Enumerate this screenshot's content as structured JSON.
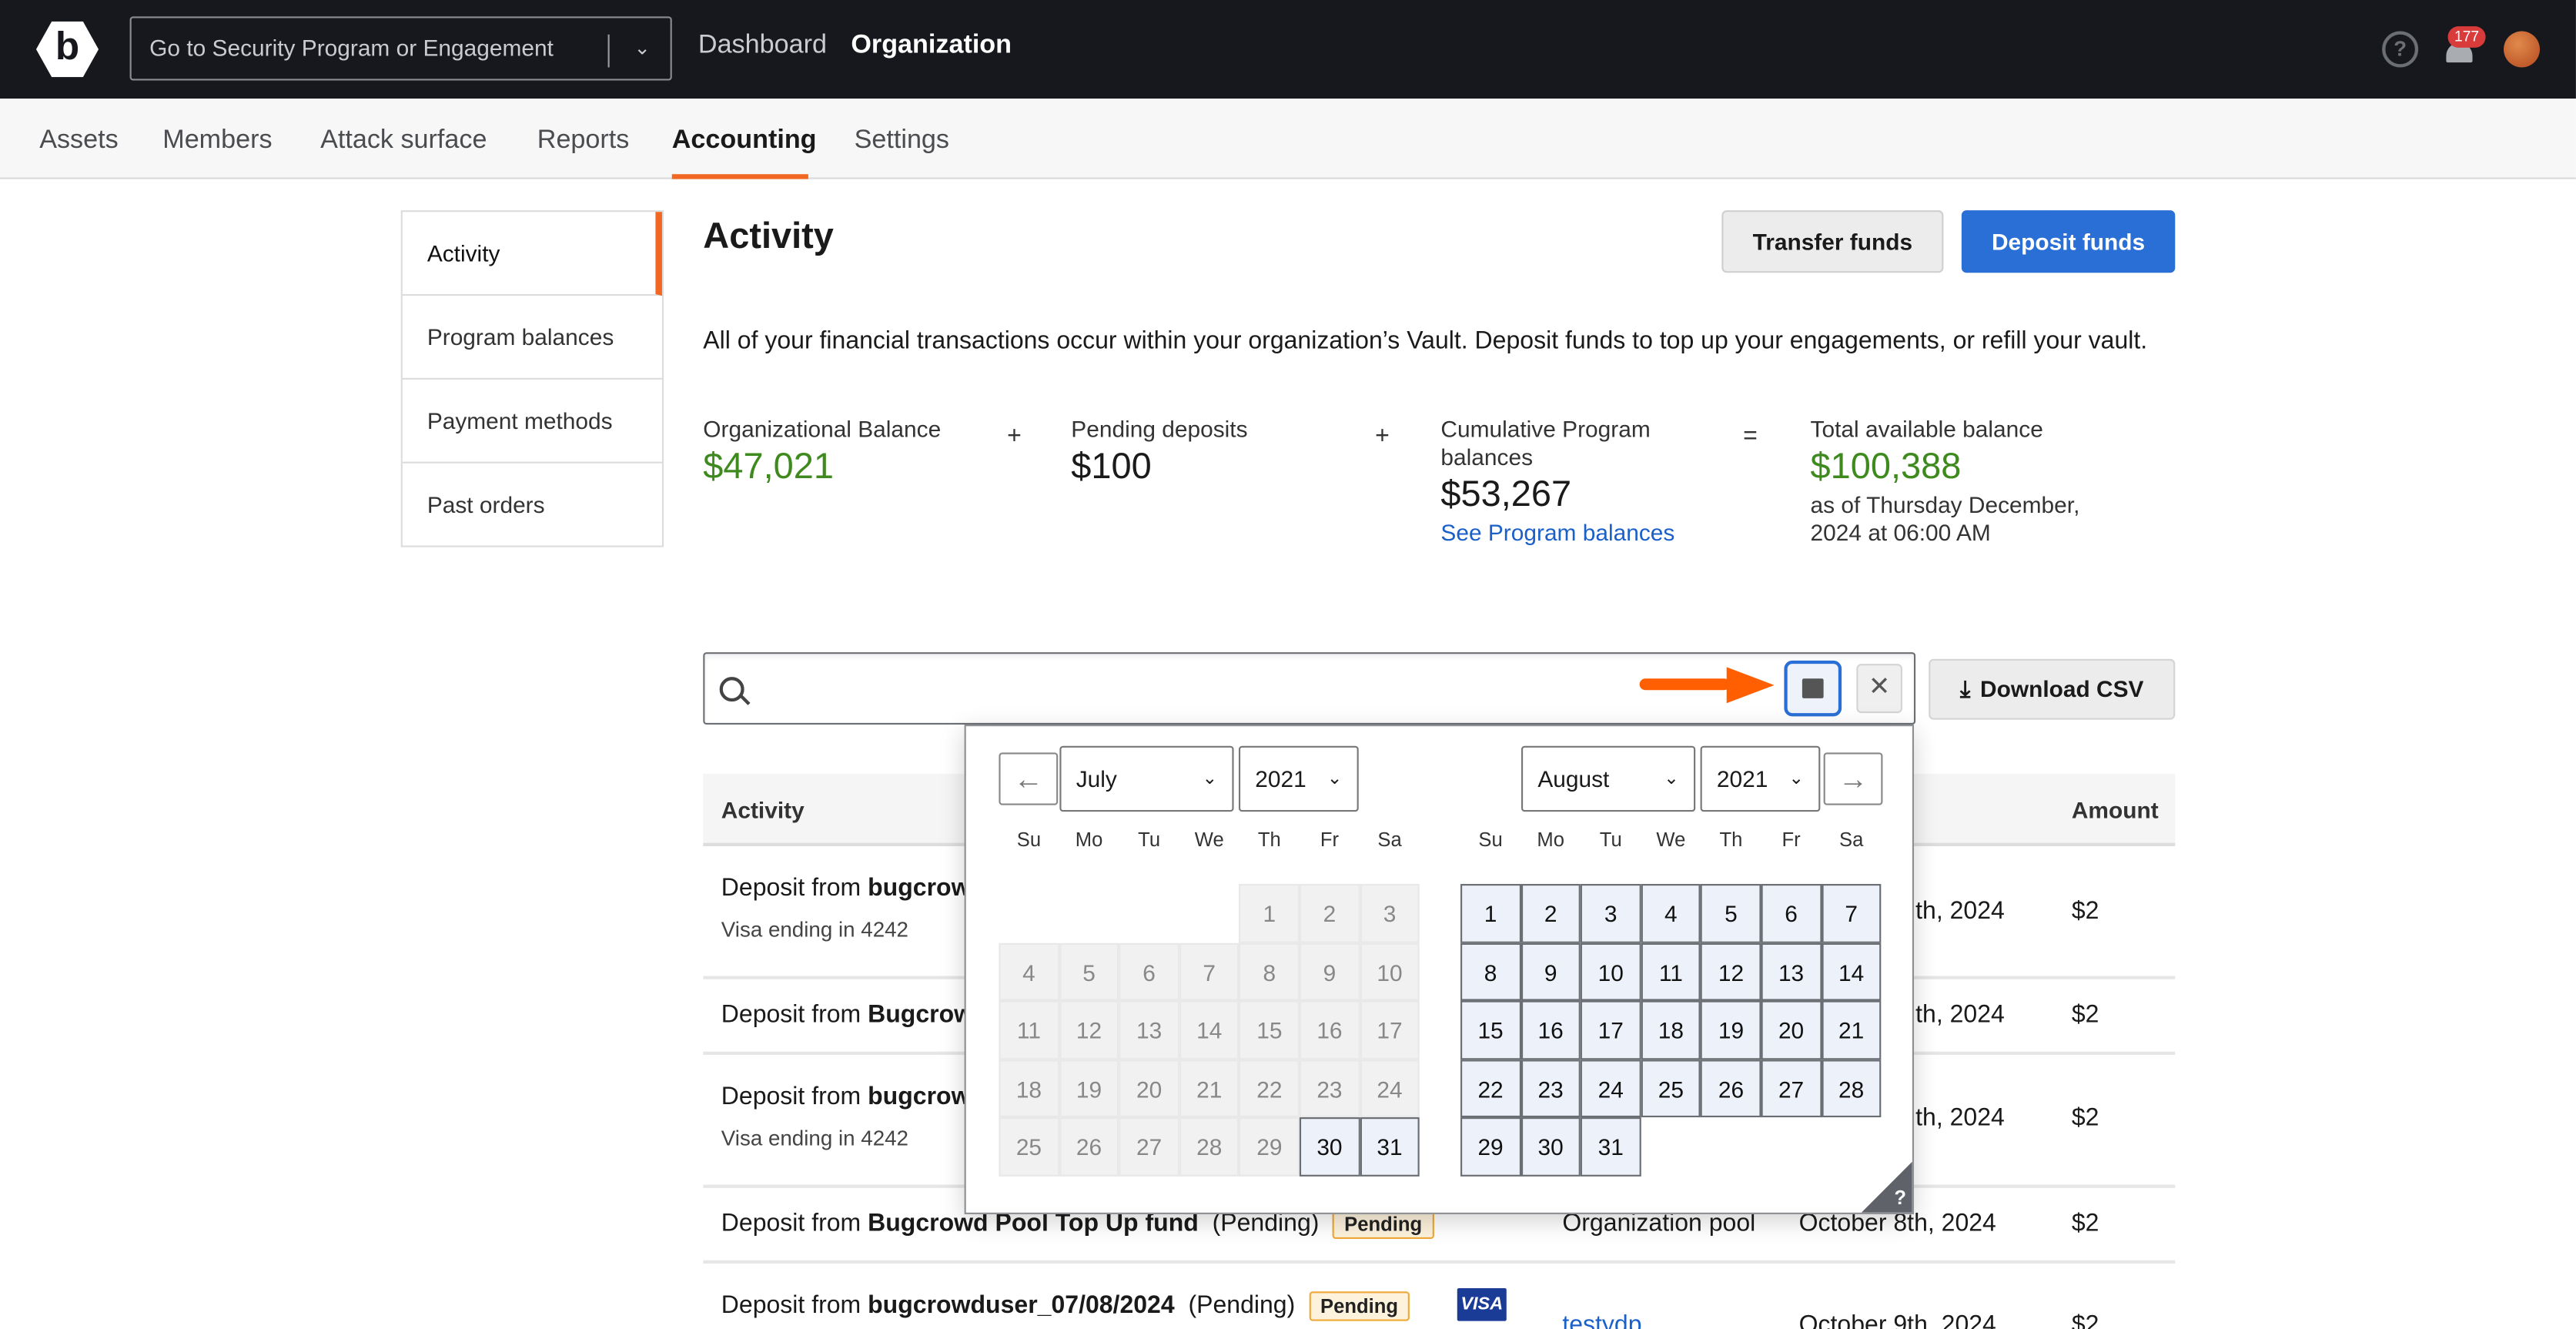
{
  "topbar": {
    "logo": "b",
    "program_select": "Go to Security Program or Engagement",
    "nav": [
      "Dashboard",
      "Organization"
    ],
    "notifications": "177",
    "icons": [
      "help-icon",
      "bell-icon",
      "avatar-basketball"
    ]
  },
  "tabs": [
    "Assets",
    "Members",
    "Attack surface",
    "Reports",
    "Accounting",
    "Settings"
  ],
  "active_tab": "Accounting",
  "sidebar": [
    "Activity",
    "Program balances",
    "Payment methods",
    "Past orders"
  ],
  "main": {
    "title": "Activity",
    "transfer_label": "Transfer funds",
    "deposit_label": "Deposit funds",
    "description": "All of your financial transactions occur within your organization’s Vault. Deposit funds to top up your engagements, or refill your vault.",
    "balances": {
      "org_label": "Organizational Balance",
      "org_value": "$47,021",
      "pending_label": "Pending deposits",
      "pending_value": "$100",
      "cumulative_label": "Cumulative Program balances",
      "cumulative_value": "$53,267",
      "cumulative_link": "See Program balances",
      "total_label": "Total available balance",
      "total_value": "$100,388",
      "total_asof": "as of Thursday December, 2024 at 06:00 AM",
      "ops": [
        "+",
        "+",
        "="
      ]
    },
    "search": {
      "value": "",
      "placeholder": ""
    },
    "download_label": "Download CSV"
  },
  "table": {
    "headers": {
      "activity": "Activity",
      "amount": "Amount"
    },
    "rows": [
      {
        "prefix": "Deposit from ",
        "name": "bugcrow",
        "sub": "Visa ending in 4242",
        "date": "th, 2024",
        "amount": "$2"
      },
      {
        "prefix": "Deposit from ",
        "name": "Bugcrow",
        "date": "th, 2024",
        "amount": "$2"
      },
      {
        "prefix": "Deposit from ",
        "name": "bugcrow",
        "sub": "Visa ending in 4242",
        "date": "th, 2024",
        "amount": "$2"
      },
      {
        "prefix": "Deposit from ",
        "name": "Bugcrowd Pool Top Up fund",
        "suffix": "(Pending)",
        "badge": "Pending",
        "source": "Organization pool",
        "date": "October 8th, 2024",
        "amount": "$2"
      },
      {
        "prefix": "Deposit from ",
        "name": "bugcrowduser_07/08/2024",
        "suffix": "(Pending)",
        "badge": "Pending",
        "card": "VISA",
        "source": "testydp",
        "date": "October 9th, 2024",
        "amount": "$2"
      }
    ]
  },
  "calendar": {
    "weekdays": [
      "Su",
      "Mo",
      "Tu",
      "We",
      "Th",
      "Fr",
      "Sa"
    ],
    "help": "?",
    "left": {
      "month": "July",
      "year": "2021",
      "available_from": 30,
      "weeks": [
        [
          null,
          null,
          null,
          null,
          1,
          2,
          3
        ],
        [
          4,
          5,
          6,
          7,
          8,
          9,
          10
        ],
        [
          11,
          12,
          13,
          14,
          15,
          16,
          17
        ],
        [
          18,
          19,
          20,
          21,
          22,
          23,
          24
        ],
        [
          25,
          26,
          27,
          28,
          29,
          30,
          31
        ]
      ]
    },
    "right": {
      "month": "August",
      "year": "2021",
      "available_from": 1,
      "weeks": [
        [
          1,
          2,
          3,
          4,
          5,
          6,
          7
        ],
        [
          8,
          9,
          10,
          11,
          12,
          13,
          14
        ],
        [
          15,
          16,
          17,
          18,
          19,
          20,
          21
        ],
        [
          22,
          23,
          24,
          25,
          26,
          27,
          28
        ],
        [
          29,
          30,
          31,
          null,
          null,
          null,
          null
        ]
      ]
    }
  },
  "colors": {
    "accent": "#f26822",
    "primary": "#2a6fd6",
    "positive": "#3f8a1f",
    "topbar": "#16181d"
  }
}
